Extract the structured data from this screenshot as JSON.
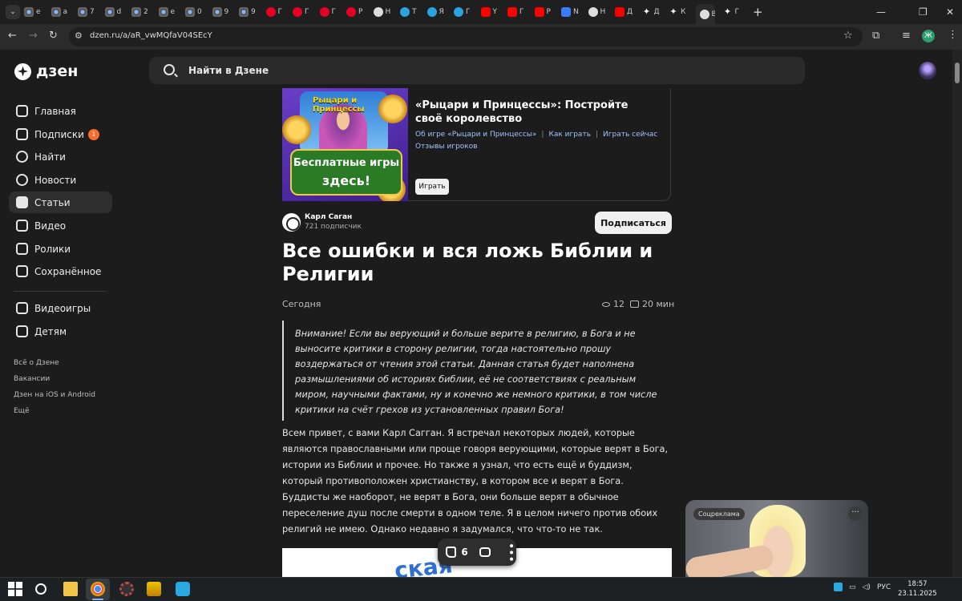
{
  "browser": {
    "tabs": [
      {
        "icon": "chrome-icon",
        "label": "e"
      },
      {
        "icon": "chrome-icon",
        "label": "a"
      },
      {
        "icon": "chrome-icon",
        "label": "7"
      },
      {
        "icon": "chrome-icon",
        "label": "d"
      },
      {
        "icon": "chrome-icon",
        "label": "2"
      },
      {
        "icon": "chrome-icon",
        "label": "e"
      },
      {
        "icon": "chrome-icon",
        "label": "0"
      },
      {
        "icon": "chrome-icon",
        "label": "9"
      },
      {
        "icon": "chrome-icon",
        "label": "9"
      },
      {
        "icon": "pinterest-icon",
        "label": "Г"
      },
      {
        "icon": "pinterest-icon",
        "label": "Г"
      },
      {
        "icon": "pinterest-icon",
        "label": "Г"
      },
      {
        "icon": "pinterest-icon",
        "label": "Р"
      },
      {
        "icon": "github-icon",
        "label": "Н"
      },
      {
        "icon": "telegram-icon",
        "label": "Т"
      },
      {
        "icon": "telegram-icon",
        "label": "Я"
      },
      {
        "icon": "telegram-icon",
        "label": "Г"
      },
      {
        "icon": "youtube-icon",
        "label": "Y"
      },
      {
        "icon": "youtube-icon",
        "label": "Г"
      },
      {
        "icon": "youtube-icon",
        "label": "Р"
      },
      {
        "icon": "messenger-icon",
        "label": "N"
      },
      {
        "icon": "github-icon",
        "label": "Н"
      },
      {
        "icon": "youtube-icon",
        "label": "Д"
      },
      {
        "icon": "star-icon",
        "label": "Д"
      },
      {
        "icon": "star-icon",
        "label": "К"
      },
      {
        "icon": "zen-icon",
        "label": "В"
      },
      {
        "icon": "star-icon",
        "label": "Г"
      }
    ],
    "active_tab_index": 25,
    "url": "dzen.ru/a/aR_vwMQfaV04SEcY",
    "profile_letter": "Ж"
  },
  "header": {
    "logo_text": "дзен",
    "search_placeholder": "Найти в Дзене"
  },
  "sidebar": {
    "items": [
      {
        "label": "Главная",
        "icon": "home-icon"
      },
      {
        "label": "Подписки",
        "icon": "subscriptions-icon",
        "badge": "1"
      },
      {
        "label": "Найти",
        "icon": "search-icon"
      },
      {
        "label": "Новости",
        "icon": "news-icon"
      },
      {
        "label": "Статьи",
        "icon": "articles-icon",
        "active": true
      },
      {
        "label": "Видео",
        "icon": "video-icon"
      },
      {
        "label": "Ролики",
        "icon": "shorts-icon"
      },
      {
        "label": "Сохранённое",
        "icon": "bookmark-icon"
      },
      {
        "label": "Видеоигры",
        "icon": "gamepad-icon"
      },
      {
        "label": "Детям",
        "icon": "kids-icon"
      }
    ],
    "footer": [
      "Всё о Дзене",
      "Вакансии",
      "Дзен на iOS и Android",
      "Ещё"
    ]
  },
  "ad": {
    "banner_logo": "Рыцари и Принцессы",
    "banner_text_1": "Бесплатные игры",
    "banner_text_2": "здесь!",
    "title": "«Рыцари и Принцессы»: Постройте своё королевство",
    "links": [
      "Об игре «Рыцари и Принцессы»",
      "Как играть",
      "Играть сейчас",
      "Отзывы игроков"
    ],
    "button": "Играть"
  },
  "article": {
    "author_name": "Карл Саган",
    "author_subs": "721 подписчик",
    "subscribe_label": "Подписаться",
    "title": "Все ошибки и вся ложь Библии и Религии",
    "date": "Сегодня",
    "views": "12",
    "read_time": "20 мин",
    "quote": "Внимание! Если вы верующий и больше верите в религию, в Бога и не выносите критики в сторону религии, тогда настоятельно прошу воздержаться от чтения этой статьи. Данная статья будет наполнена размышлениями об историях библии, её не соответствиях с реальным миром, научными фактами, ну и конечно же немного критики, в том числе критики на счёт грехов из установленных правил Бога!",
    "body": "Всем привет, с вами Карл Сагган. Я встречал некоторых людей, которые являются православными или проще говоря верующими, которые верят в Бога, истории из Библии и прочее. Но также я узнал, что есть ещё и буддизм, который противоположен христианству, в котором все и верят в Бога. Буддисты же наоборот, не верят в Бога, они больше верят в обычное переселение душ после смерти в одном теле. Я в целом ничего против обоих религий не имею. Однако недавно я задумался, что что-то не так.",
    "image_caption_partial": "ская",
    "likes": "6"
  },
  "video_ad": {
    "label": "Соцреклама"
  },
  "taskbar": {
    "language": "РУС",
    "time": "18:57",
    "date": "23.11.2025"
  }
}
